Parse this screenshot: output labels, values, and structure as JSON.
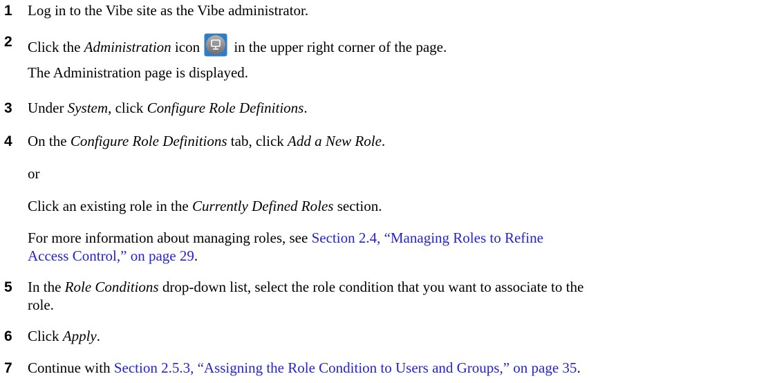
{
  "steps": [
    {
      "num": "1",
      "text": "Log in to the Vibe site as the Vibe administrator."
    },
    {
      "num": "2",
      "pre": "Click the ",
      "em": "Administration",
      "mid": " icon",
      "post": " in the upper right corner of the page."
    },
    {
      "num": "3",
      "pre": "Under ",
      "em1": "System",
      "mid": ", click ",
      "em2": "Configure Role Definitions",
      "post": "."
    },
    {
      "num": "4",
      "pre": "On the ",
      "em1": "Configure Role Definitions",
      "mid": " tab, click ",
      "em2": "Add a New Role",
      "post": "."
    },
    {
      "num": "5",
      "pre": "In the ",
      "em": "Role Conditions",
      "post_line1": " drop-down list, select the role condition that you want to associate to the",
      "line2": "role."
    },
    {
      "num": "6",
      "pre": "Click ",
      "em": "Apply",
      "post": "."
    },
    {
      "num": "7",
      "pre": "Continue with ",
      "link": "Section 2.5.3, “Assigning the Role Condition to Users and Groups,” on page 35",
      "post": "."
    }
  ],
  "step2_result": "The Administration page is displayed.",
  "step4_or": "or",
  "step4_alt": {
    "pre": "Click an existing role in the ",
    "em": "Currently Defined Roles",
    "post": " section."
  },
  "step4_info": {
    "pre": "For more information about managing roles, see ",
    "link_line1": "Section 2.4, “Managing Roles to Refine",
    "link_line2": "Access Control,” on page 29",
    "post": "."
  },
  "icons": {
    "administration": "administration-icon"
  },
  "colors": {
    "link": "#2323d6"
  }
}
